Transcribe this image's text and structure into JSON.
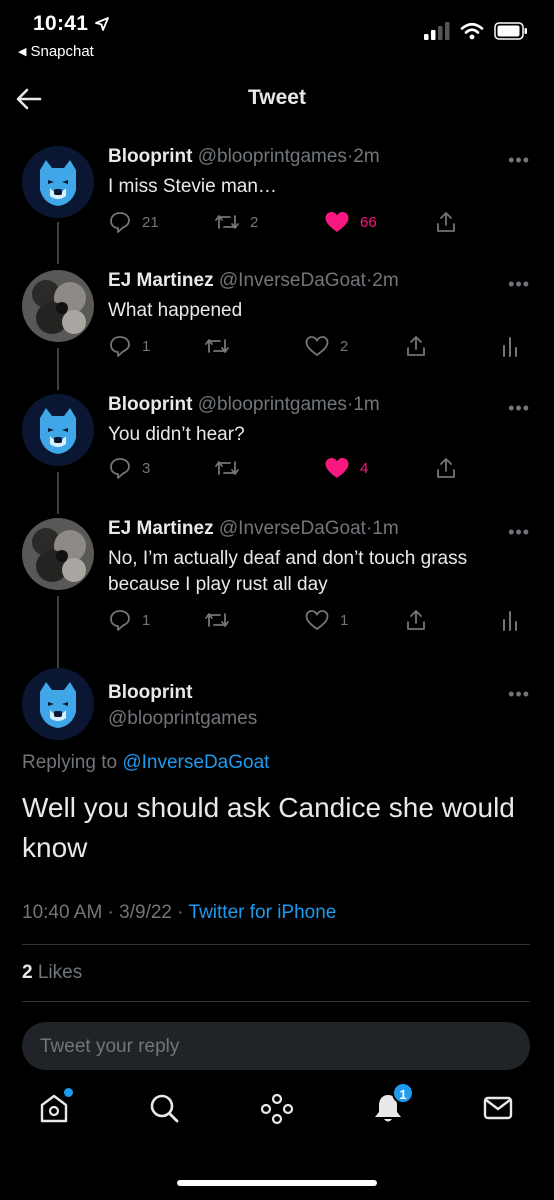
{
  "status_bar": {
    "time": "10:41",
    "back_app": "Snapchat"
  },
  "header": {
    "title": "Tweet"
  },
  "tweets": [
    {
      "name": "Blooprint",
      "handle": "@blooprintgames",
      "sep": "·",
      "time": "2m",
      "text": "I miss Stevie man…",
      "replies": "21",
      "retweets": "2",
      "likes": "66",
      "liked": true
    },
    {
      "name": "EJ Martinez",
      "handle": "@InverseDaGoat",
      "sep": "·",
      "time": "2m",
      "text": "What happened",
      "replies": "1",
      "retweets": "",
      "likes": "2",
      "liked": false
    },
    {
      "name": "Blooprint",
      "handle": "@blooprintgames",
      "sep": "·",
      "time": "1m",
      "text": "You didn’t hear?",
      "replies": "3",
      "retweets": "",
      "likes": "4",
      "liked": true
    },
    {
      "name": "EJ Martinez",
      "handle": "@InverseDaGoat",
      "sep": "·",
      "time": "1m",
      "text": "No, I’m actually deaf and don’t touch grass because I play rust all day",
      "replies": "1",
      "retweets": "",
      "likes": "1",
      "liked": false
    }
  ],
  "main_tweet": {
    "name": "Blooprint",
    "handle": "@blooprintgames",
    "replying_prefix": "Replying to",
    "replying_to": "@InverseDaGoat",
    "text": "Well you should ask Candice she would know",
    "timestamp": "10:40 AM · 3/9/22 · ",
    "source": "Twitter for iPhone",
    "likes_count": "2",
    "likes_label": "Likes"
  },
  "reply_bar": {
    "placeholder": "Tweet your reply"
  },
  "tabbar": {
    "notifications_count": "1"
  },
  "colors": {
    "accent": "#1d9bf0",
    "like": "#f91880",
    "muted": "#71767b",
    "background": "#000000"
  }
}
